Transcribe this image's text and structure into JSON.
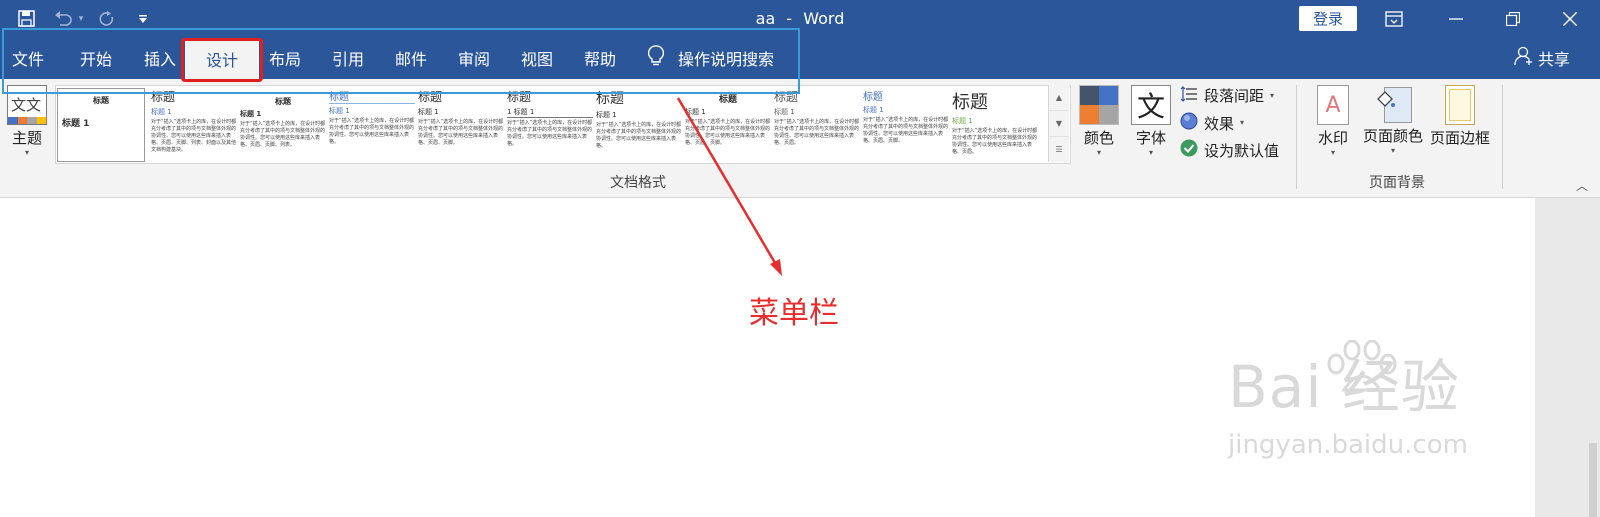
{
  "title_bar": {
    "doc_name": "aa",
    "separator": "-",
    "app_name": "Word",
    "login_label": "登录",
    "icons": [
      "save-icon",
      "undo-icon",
      "redo-icon",
      "customize-qat-icon",
      "ribbon-display-icon",
      "minimize-icon",
      "restore-icon",
      "close-icon"
    ]
  },
  "tabs": [
    {
      "label": "文件"
    },
    {
      "label": "开始"
    },
    {
      "label": "插入"
    },
    {
      "label": "设计",
      "active": true
    },
    {
      "label": "布局"
    },
    {
      "label": "引用"
    },
    {
      "label": "邮件"
    },
    {
      "label": "审阅"
    },
    {
      "label": "视图"
    },
    {
      "label": "帮助"
    }
  ],
  "tell_me": {
    "label": "操作说明搜索",
    "icon": "lightbulb-icon"
  },
  "share": {
    "label": "共享",
    "icon": "person-icon"
  },
  "ribbon": {
    "themes": {
      "label": "主题",
      "icon_text": "文文"
    },
    "gallery": {
      "items": [
        {
          "title": "标题",
          "heading": "标题 1",
          "body": ""
        },
        {
          "title": "标题",
          "heading": "标题 1",
          "body": "对于“插入”选项卡上的库，在设计时都充分考虑了其中的项与文档整体外观的协调性。您可以使用这些库来插入表格、页眉、页脚、列表、封面以及其他文档构建基块。"
        },
        {
          "title": "标题",
          "heading": "标题 1",
          "body": "对于“插入”选项卡上的库，在设计时都充分考虑了其中的项与文档整体外观的协调性。您可以使用这些库来插入表格、页眉、页脚、列表。"
        },
        {
          "title": "标题",
          "heading": "标题 1",
          "body": "对于“插入”选项卡上的库，在设计时都充分考虑了其中的项与文档整体外观的协调性。您可以使用这些库来插入表格。"
        },
        {
          "title": "标题",
          "heading": "标题 1",
          "body": "对于“插入”选项卡上的库，在设计时都充分考虑了其中的项与文档整体外观的协调性。您可以使用这些库来插入表格、页眉、页脚。"
        },
        {
          "title": "标题",
          "heading": "1 标题 1",
          "body": "对于“插入”选项卡上的库，在设计时都充分考虑了其中的项与文档整体外观的协调性。您可以使用这些库来插入表格。"
        },
        {
          "title": "标题",
          "heading": "标题 1",
          "body": "对于“插入”选项卡上的库，在设计时都充分考虑了其中的项与文档整体外观的协调性。您可以使用这些库来插入表格。"
        },
        {
          "title": "标题",
          "heading": "标题 1",
          "body": "对于“插入”选项卡上的库，在设计时都充分考虑了其中的项与文档整体外观的协调性。您可以使用这些库来插入表格、页眉、页脚。"
        },
        {
          "title": "标题",
          "heading": "标题 1",
          "body": "对于“插入”选项卡上的库，在设计时都充分考虑了其中的项与文档整体外观的协调性。您可以使用这些库来插入表格、页眉。"
        },
        {
          "title": "标题",
          "heading": "标题 1",
          "body": "对于“插入”选项卡上的库，在设计时都充分考虑了其中的项与文档整体外观的协调性。您可以使用这些库来插入表格、页眉、页脚。"
        },
        {
          "title": "标题",
          "heading": "标题 1",
          "body": "对于“插入”选项卡上的库，在设计时都充分考虑了其中的项与文档整体外观的协调性。您可以使用这些库来插入表格、页眉。"
        }
      ]
    },
    "doc_format_label": "文档格式",
    "colors_label": "颜色",
    "fonts_label": "字体",
    "fonts_icon_text": "文",
    "paragraph_spacing_label": "段落间距",
    "effects_label": "效果",
    "set_default_label": "设为默认值",
    "watermark_label": "水印",
    "page_color_label": "页面颜色",
    "page_borders_label": "页面边框",
    "page_background_label": "页面背景",
    "theme_colors": [
      "#44546a",
      "#4472c4",
      "#ed7d31",
      "#a5a5a5"
    ],
    "watermark_icon_text": "A"
  },
  "annotation": {
    "label": "菜单栏"
  },
  "watermark": {
    "brand": "Bai  经验",
    "url": "jingyan.baidu.com"
  }
}
